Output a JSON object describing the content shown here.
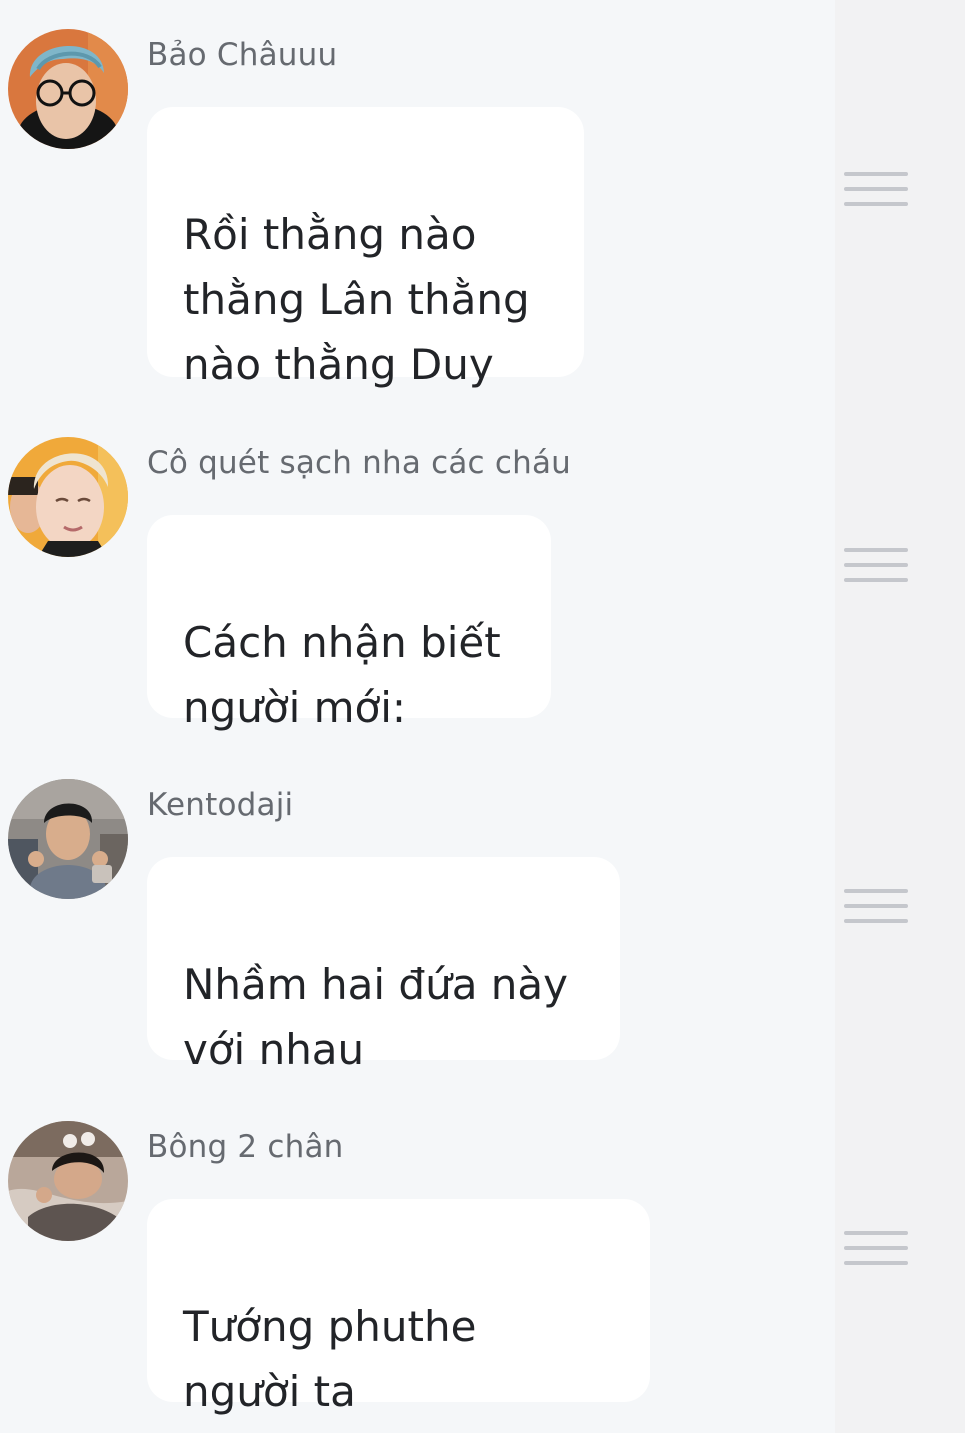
{
  "messages": [
    {
      "sender": "Bảo Châuuu",
      "avatar_icon": "avatar-photo-blue-hair-glasses",
      "text": "Rồi thằng nào\nthằng Lân thằng\nnào thằng Duy",
      "menu_icon": "drag-handle-icon"
    },
    {
      "sender": "Cô quét sạch nha các cháu",
      "avatar_icon": "avatar-photo-blond-hair",
      "text": "Cách nhận biết\nngười mới:",
      "menu_icon": "drag-handle-icon"
    },
    {
      "sender": "Kentodaji",
      "avatar_icon": "avatar-photo-peace-signs",
      "text": "Nhầm hai đứa này\nvới nhau",
      "menu_icon": "drag-handle-icon"
    },
    {
      "sender": "Bông 2 chân",
      "avatar_icon": "avatar-photo-lying-down",
      "text": "Tướng phuthe\nngười ta",
      "menu_icon": "drag-handle-icon"
    }
  ],
  "colors": {
    "background": "#f5f7f9",
    "right_panel": "#f2f2f3",
    "bubble": "#ffffff",
    "sender_text": "#666a70",
    "message_text": "#222428",
    "menu_lines": "#c5c7cc"
  }
}
